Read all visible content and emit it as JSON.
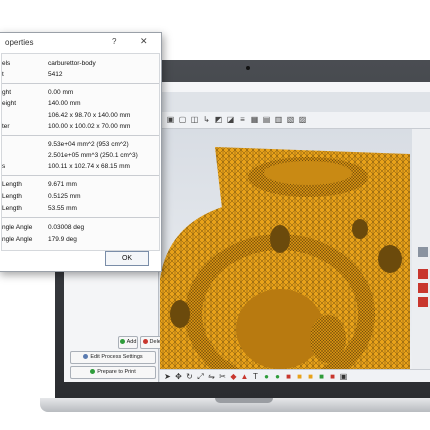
{
  "dialog": {
    "title": "operties",
    "help": "?",
    "close": "✕",
    "ok_label": "OK",
    "rows": [
      {
        "label": "els",
        "value": "carburettor-body"
      },
      {
        "label": "t",
        "value": "5412"
      },
      {
        "label": "ght",
        "value": "0.00 mm"
      },
      {
        "label": "eight",
        "value": "140.00 mm"
      },
      {
        "label": "",
        "value": "106.42 x 98.70 x 140.00 mm"
      },
      {
        "label": "ter",
        "value": "100.00 x 100.02 x 70.00 mm"
      },
      {
        "label": "",
        "value": "9.53e+04 mm^2 (953 cm^2)"
      },
      {
        "label": "",
        "value": "2.501e+05 mm^3 (250.1 cm^3)"
      },
      {
        "label": "s",
        "value": "100.11 x 102.74 x 68.15 mm"
      },
      {
        "label": "Length",
        "value": "9.671 mm"
      },
      {
        "label": "Length",
        "value": "0.5125 mm"
      },
      {
        "label": "Length",
        "value": "53.55 mm"
      },
      {
        "label": "ngle Angle",
        "value": "0.03008 deg"
      },
      {
        "label": "ngle Angle",
        "value": "179.9 deg"
      }
    ]
  },
  "left_panel": {
    "add_label": "Add",
    "delete_label": "Delete",
    "edit_process_label": "Edit Process Settings",
    "prepare_label": "Prepare to Print"
  },
  "colors": {
    "model": "#e8a21a",
    "mesh_line": "#6b4a0c",
    "accent_green": "#2e9c3a",
    "delete_red": "#c8362e"
  },
  "icons": {
    "toolbar": [
      "cube-icon",
      "cube-front-icon",
      "cube-side-icon",
      "axis-icon",
      "view-icon",
      "view-icon",
      "layers-icon",
      "view-icon",
      "view-icon",
      "view-icon",
      "view-icon",
      "view-icon"
    ],
    "bottom": [
      "pointer-icon",
      "move-icon",
      "rotate-icon",
      "scale-icon",
      "mirror-icon",
      "cut-icon",
      "measure-icon",
      "support-icon",
      "text-icon",
      "color-icon",
      "shell-icon",
      "hollow-icon",
      "drain-icon",
      "layer-icon",
      "paint-icon",
      "seam-icon",
      "more-icon"
    ]
  }
}
